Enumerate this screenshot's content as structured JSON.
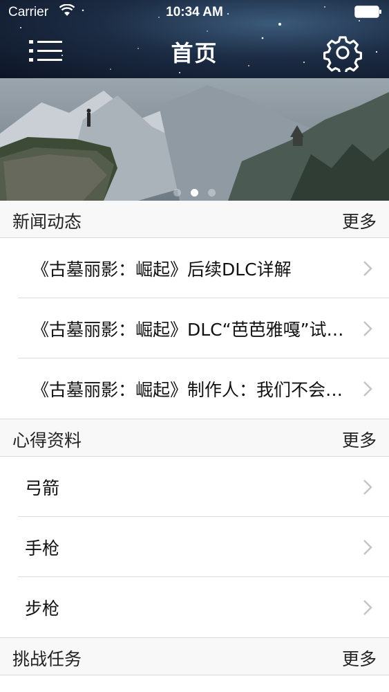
{
  "status_bar": {
    "carrier": "Carrier",
    "time": "10:34 AM"
  },
  "nav": {
    "title": "首页",
    "menu_icon": "list-menu-icon",
    "settings_icon": "gear-icon"
  },
  "banner": {
    "active_slide": 2,
    "slide_count": 3
  },
  "sections": [
    {
      "title": "新闻动态",
      "more": "更多",
      "items": [
        {
          "label": "《古墓丽影：崛起》后续DLC详解"
        },
        {
          "label": "《古墓丽影：崛起》DLC“芭芭雅嘎”试玩视频"
        },
        {
          "label": "《古墓丽影：崛起》制作人：我们不会再做"
        }
      ]
    },
    {
      "title": "心得资料",
      "more": "更多",
      "items": [
        {
          "label": "弓箭"
        },
        {
          "label": "手枪"
        },
        {
          "label": "步枪"
        }
      ]
    },
    {
      "title": "挑战任务",
      "more": "更多",
      "items": []
    }
  ]
}
